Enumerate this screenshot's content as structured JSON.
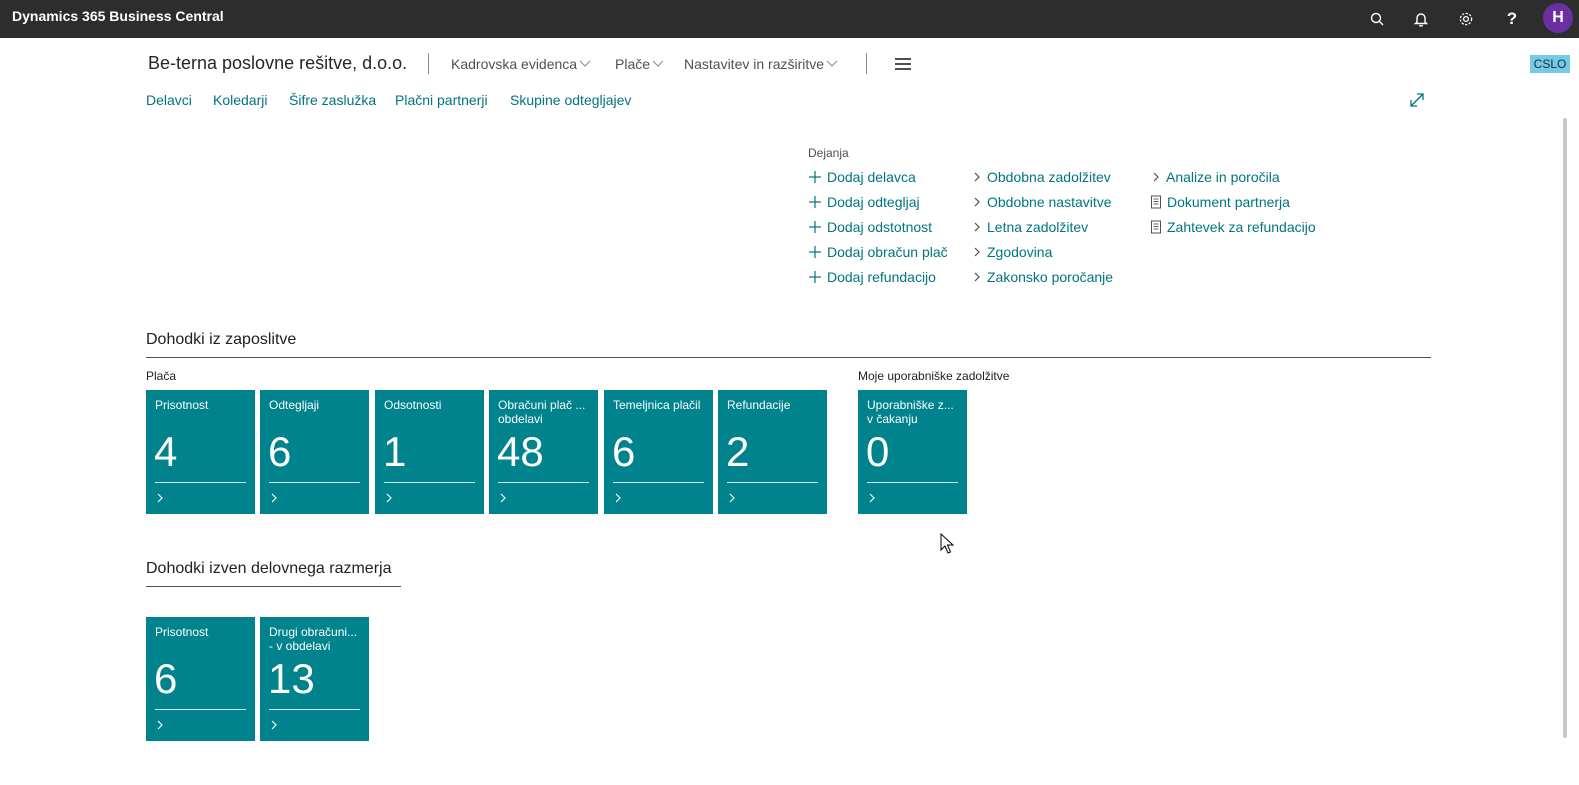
{
  "app": {
    "title": "Dynamics 365 Business Central",
    "user_initial": "H",
    "badge": "CSLO"
  },
  "topbar_icons": [
    "search-icon",
    "bell-icon",
    "gear-icon",
    "help-icon"
  ],
  "header": {
    "company": "Be-terna poslovne rešitve, d.o.o.",
    "menus": [
      "Kadrovska evidenca",
      "Plače",
      "Nastavitev in razširitve"
    ]
  },
  "nav": [
    "Delavci",
    "Koledarji",
    "Šifre zaslužka",
    "Plačni partnerji",
    "Skupine odtegljajev"
  ],
  "actions": {
    "title": "Dejanja",
    "col1": [
      "Dodaj delavca",
      "Dodaj odtegljaj",
      "Dodaj odstotnost",
      "Dodaj obračun plač",
      "Dodaj refundacijo"
    ],
    "col2": [
      "Obdobna zadolžitev",
      "Obdobne nastavitve",
      "Letna zadolžitev",
      "Zgodovina",
      "Zakonsko poročanje"
    ],
    "col3": [
      "Analize in poročila",
      "Dokument partnerja",
      "Zahtevek za refundacijo"
    ]
  },
  "section1": {
    "title": "Dohodki iz zaposlitve",
    "group1": {
      "title": "Plača",
      "tiles": [
        {
          "label": "Prisotnost",
          "value": "4"
        },
        {
          "label": "Odtegljaji",
          "value": "6"
        },
        {
          "label": "Odsotnosti",
          "value": "1"
        },
        {
          "label": "Obračuni plač ... obdelavi",
          "value": "48"
        },
        {
          "label": "Temeljnica plačil",
          "value": "6"
        },
        {
          "label": "Refundacije",
          "value": "2"
        }
      ]
    },
    "group2": {
      "title": "Moje uporabniške zadolžitve",
      "tiles": [
        {
          "label": "Uporabniške z... v čakanju",
          "value": "0"
        }
      ]
    }
  },
  "section2": {
    "title": "Dohodki izven delovnega razmerja",
    "tiles": [
      {
        "label": "Prisotnost",
        "value": "6"
      },
      {
        "label": "Drugi obračuni... - v obdelavi",
        "value": "13"
      }
    ]
  }
}
